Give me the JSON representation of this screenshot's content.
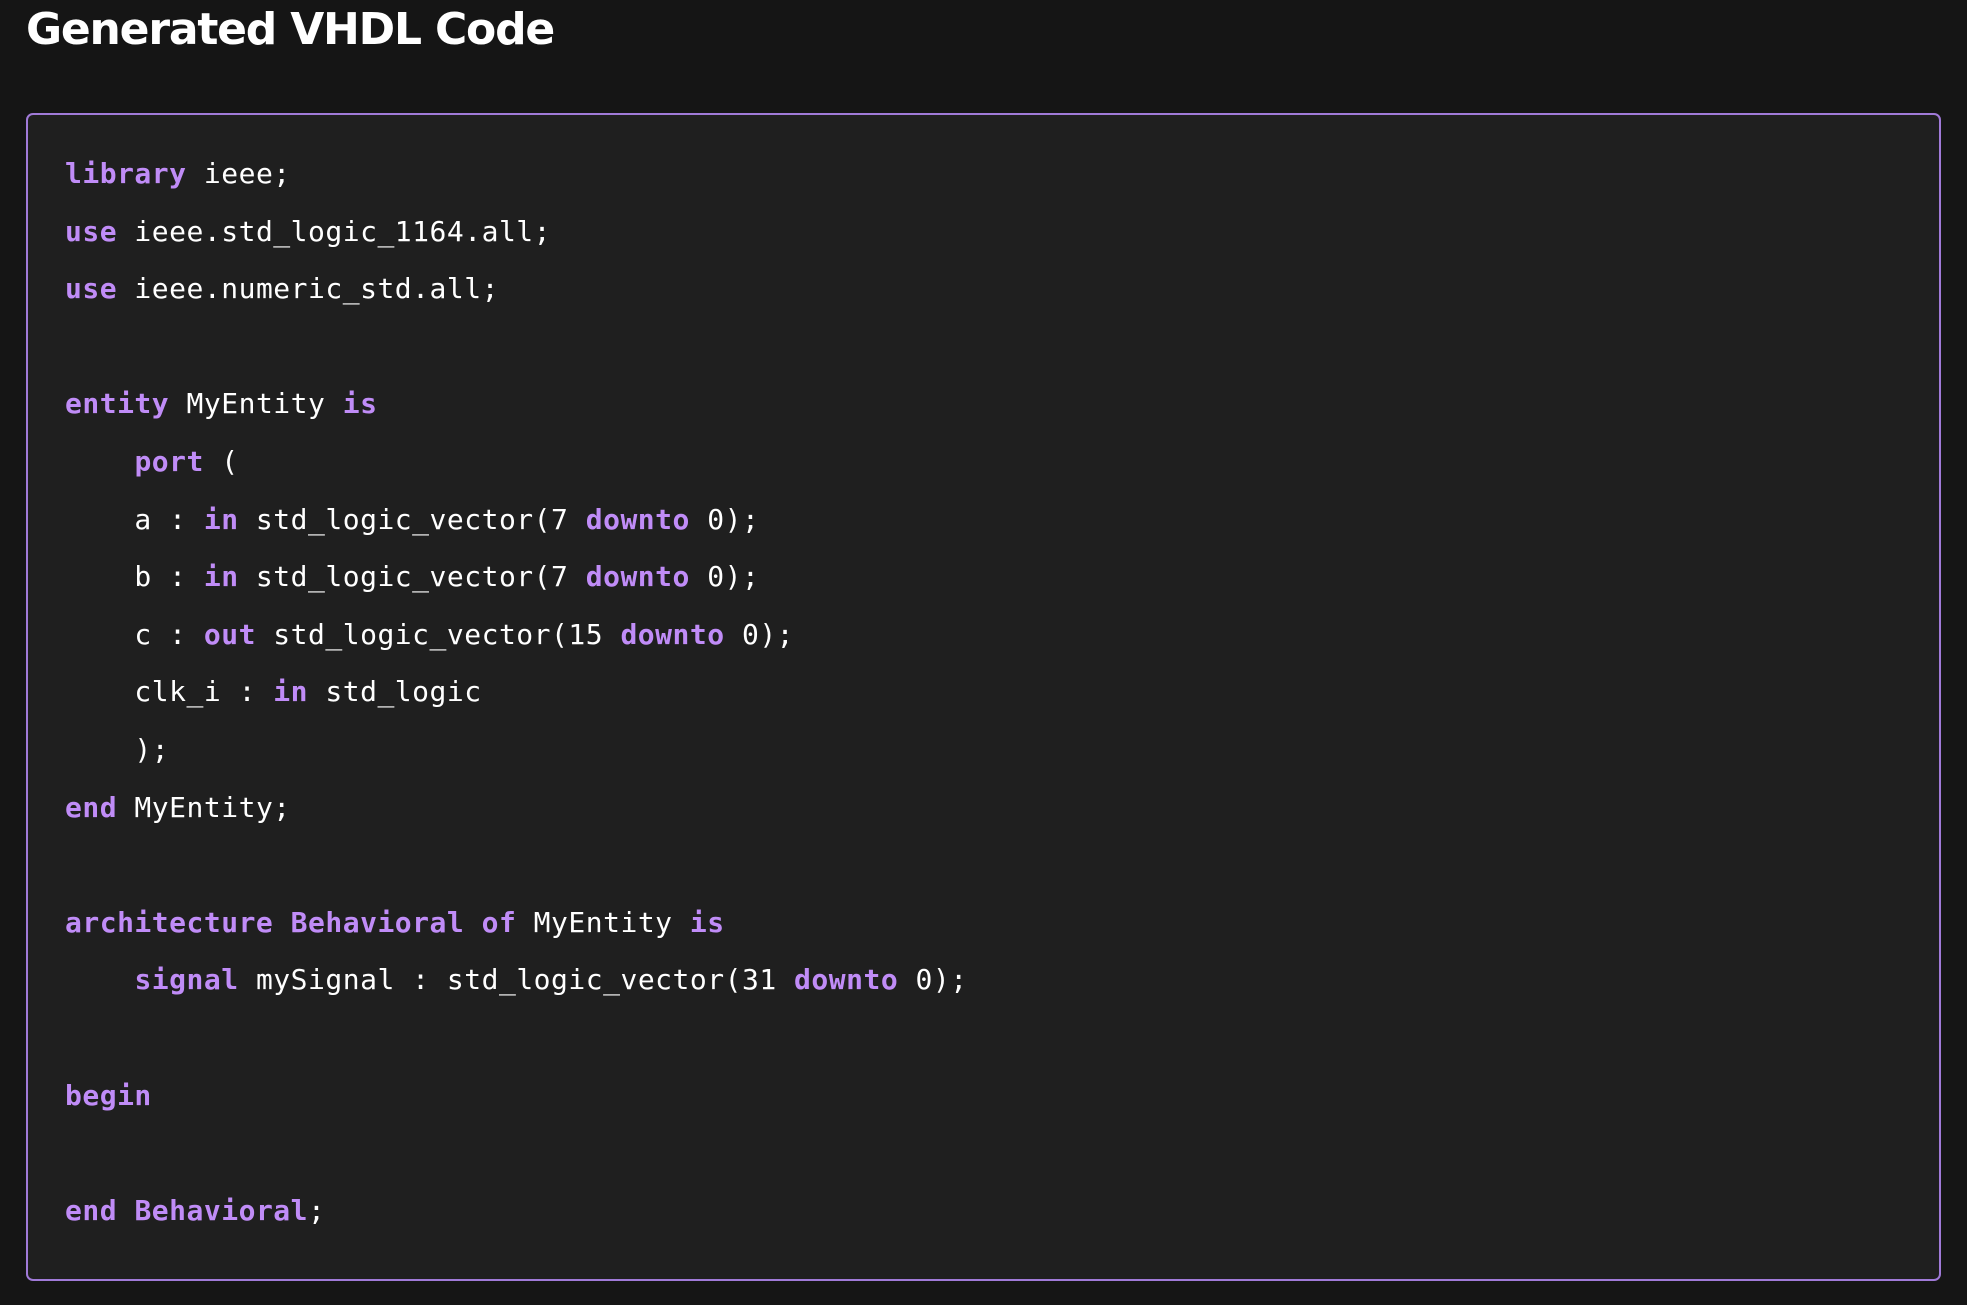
{
  "page": {
    "title": "Generated VHDL Code"
  },
  "colors": {
    "background": "#151515",
    "panel": "#1f1f1f",
    "panel_border": "#a07ad8",
    "keyword": "#c08cf7",
    "text": "#ffffff"
  },
  "code": {
    "language": "vhdl",
    "lines": [
      [
        {
          "t": "library",
          "k": true
        },
        {
          "t": " ieee;"
        }
      ],
      [
        {
          "t": "use",
          "k": true
        },
        {
          "t": " ieee.std_logic_1164.all;"
        }
      ],
      [
        {
          "t": "use",
          "k": true
        },
        {
          "t": " ieee.numeric_std.all;"
        }
      ],
      [],
      [
        {
          "t": "entity",
          "k": true
        },
        {
          "t": " MyEntity "
        },
        {
          "t": "is",
          "k": true
        }
      ],
      [
        {
          "t": "    "
        },
        {
          "t": "port",
          "k": true
        },
        {
          "t": " ("
        }
      ],
      [
        {
          "t": "    a : "
        },
        {
          "t": "in",
          "k": true
        },
        {
          "t": " std_logic_vector(7 "
        },
        {
          "t": "downto",
          "k": true
        },
        {
          "t": " 0);"
        }
      ],
      [
        {
          "t": "    b : "
        },
        {
          "t": "in",
          "k": true
        },
        {
          "t": " std_logic_vector(7 "
        },
        {
          "t": "downto",
          "k": true
        },
        {
          "t": " 0);"
        }
      ],
      [
        {
          "t": "    c : "
        },
        {
          "t": "out",
          "k": true
        },
        {
          "t": " std_logic_vector(15 "
        },
        {
          "t": "downto",
          "k": true
        },
        {
          "t": " 0);"
        }
      ],
      [
        {
          "t": "    clk_i : "
        },
        {
          "t": "in",
          "k": true
        },
        {
          "t": " std_logic"
        }
      ],
      [
        {
          "t": "    );"
        }
      ],
      [
        {
          "t": "end",
          "k": true
        },
        {
          "t": " MyEntity;"
        }
      ],
      [],
      [
        {
          "t": "architecture",
          "k": true
        },
        {
          "t": " "
        },
        {
          "t": "Behavioral",
          "k": true
        },
        {
          "t": " "
        },
        {
          "t": "of",
          "k": true
        },
        {
          "t": " MyEntity "
        },
        {
          "t": "is",
          "k": true
        }
      ],
      [
        {
          "t": "    "
        },
        {
          "t": "signal",
          "k": true
        },
        {
          "t": " mySignal : std_logic_vector(31 "
        },
        {
          "t": "downto",
          "k": true
        },
        {
          "t": " 0);"
        }
      ],
      [],
      [
        {
          "t": "begin",
          "k": true
        }
      ],
      [],
      [
        {
          "t": "end",
          "k": true
        },
        {
          "t": " "
        },
        {
          "t": "Behavioral",
          "k": true
        },
        {
          "t": ";"
        }
      ]
    ]
  }
}
